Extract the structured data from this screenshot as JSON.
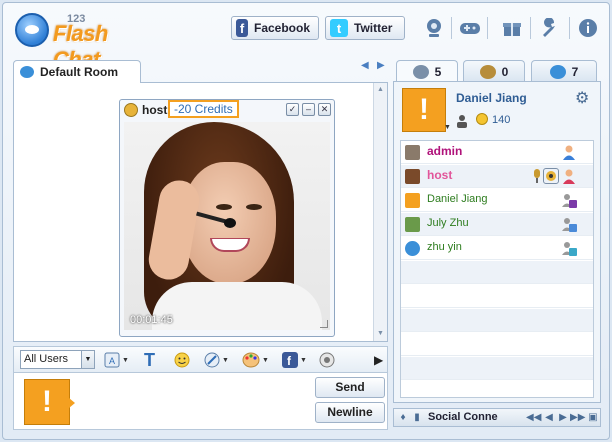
{
  "app": {
    "logo_small": "123",
    "logo_big": "Flash Chat"
  },
  "header": {
    "facebook_label": "Facebook",
    "twitter_label": "Twitter"
  },
  "chat": {
    "room_tab": "Default Room",
    "video": {
      "user": "host",
      "credits": "-20 Credits",
      "timer": "00:01:45"
    },
    "toolbar": {
      "users_select": "All Users"
    },
    "send_label": "Send",
    "newline_label": "Newline"
  },
  "right": {
    "tabs": [
      {
        "count": "5"
      },
      {
        "count": "0"
      },
      {
        "count": "7"
      }
    ],
    "me": {
      "name": "Daniel Jiang",
      "credits": "140"
    },
    "users": [
      {
        "name": "admin",
        "color": "#b0127a"
      },
      {
        "name": "host",
        "color": "#e2559a"
      },
      {
        "name": "Daniel Jiang",
        "color": "#2e7d1f"
      },
      {
        "name": "July Zhu",
        "color": "#2e7d1f"
      },
      {
        "name": "zhu yin",
        "color": "#2e7d1f"
      }
    ],
    "bottom_label": "Social Conne"
  }
}
